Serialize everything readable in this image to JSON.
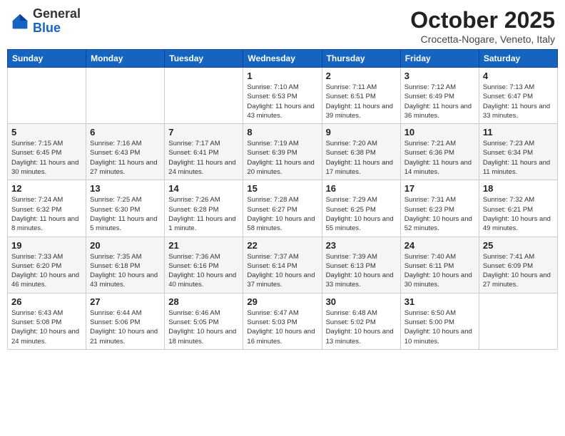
{
  "header": {
    "logo_general": "General",
    "logo_blue": "Blue",
    "month_title": "October 2025",
    "subtitle": "Crocetta-Nogare, Veneto, Italy"
  },
  "weekdays": [
    "Sunday",
    "Monday",
    "Tuesday",
    "Wednesday",
    "Thursday",
    "Friday",
    "Saturday"
  ],
  "weeks": [
    [
      {
        "day": "",
        "sunrise": "",
        "sunset": "",
        "daylight": ""
      },
      {
        "day": "",
        "sunrise": "",
        "sunset": "",
        "daylight": ""
      },
      {
        "day": "",
        "sunrise": "",
        "sunset": "",
        "daylight": ""
      },
      {
        "day": "1",
        "sunrise": "Sunrise: 7:10 AM",
        "sunset": "Sunset: 6:53 PM",
        "daylight": "Daylight: 11 hours and 43 minutes."
      },
      {
        "day": "2",
        "sunrise": "Sunrise: 7:11 AM",
        "sunset": "Sunset: 6:51 PM",
        "daylight": "Daylight: 11 hours and 39 minutes."
      },
      {
        "day": "3",
        "sunrise": "Sunrise: 7:12 AM",
        "sunset": "Sunset: 6:49 PM",
        "daylight": "Daylight: 11 hours and 36 minutes."
      },
      {
        "day": "4",
        "sunrise": "Sunrise: 7:13 AM",
        "sunset": "Sunset: 6:47 PM",
        "daylight": "Daylight: 11 hours and 33 minutes."
      }
    ],
    [
      {
        "day": "5",
        "sunrise": "Sunrise: 7:15 AM",
        "sunset": "Sunset: 6:45 PM",
        "daylight": "Daylight: 11 hours and 30 minutes."
      },
      {
        "day": "6",
        "sunrise": "Sunrise: 7:16 AM",
        "sunset": "Sunset: 6:43 PM",
        "daylight": "Daylight: 11 hours and 27 minutes."
      },
      {
        "day": "7",
        "sunrise": "Sunrise: 7:17 AM",
        "sunset": "Sunset: 6:41 PM",
        "daylight": "Daylight: 11 hours and 24 minutes."
      },
      {
        "day": "8",
        "sunrise": "Sunrise: 7:19 AM",
        "sunset": "Sunset: 6:39 PM",
        "daylight": "Daylight: 11 hours and 20 minutes."
      },
      {
        "day": "9",
        "sunrise": "Sunrise: 7:20 AM",
        "sunset": "Sunset: 6:38 PM",
        "daylight": "Daylight: 11 hours and 17 minutes."
      },
      {
        "day": "10",
        "sunrise": "Sunrise: 7:21 AM",
        "sunset": "Sunset: 6:36 PM",
        "daylight": "Daylight: 11 hours and 14 minutes."
      },
      {
        "day": "11",
        "sunrise": "Sunrise: 7:23 AM",
        "sunset": "Sunset: 6:34 PM",
        "daylight": "Daylight: 11 hours and 11 minutes."
      }
    ],
    [
      {
        "day": "12",
        "sunrise": "Sunrise: 7:24 AM",
        "sunset": "Sunset: 6:32 PM",
        "daylight": "Daylight: 11 hours and 8 minutes."
      },
      {
        "day": "13",
        "sunrise": "Sunrise: 7:25 AM",
        "sunset": "Sunset: 6:30 PM",
        "daylight": "Daylight: 11 hours and 5 minutes."
      },
      {
        "day": "14",
        "sunrise": "Sunrise: 7:26 AM",
        "sunset": "Sunset: 6:28 PM",
        "daylight": "Daylight: 11 hours and 1 minute."
      },
      {
        "day": "15",
        "sunrise": "Sunrise: 7:28 AM",
        "sunset": "Sunset: 6:27 PM",
        "daylight": "Daylight: 10 hours and 58 minutes."
      },
      {
        "day": "16",
        "sunrise": "Sunrise: 7:29 AM",
        "sunset": "Sunset: 6:25 PM",
        "daylight": "Daylight: 10 hours and 55 minutes."
      },
      {
        "day": "17",
        "sunrise": "Sunrise: 7:31 AM",
        "sunset": "Sunset: 6:23 PM",
        "daylight": "Daylight: 10 hours and 52 minutes."
      },
      {
        "day": "18",
        "sunrise": "Sunrise: 7:32 AM",
        "sunset": "Sunset: 6:21 PM",
        "daylight": "Daylight: 10 hours and 49 minutes."
      }
    ],
    [
      {
        "day": "19",
        "sunrise": "Sunrise: 7:33 AM",
        "sunset": "Sunset: 6:20 PM",
        "daylight": "Daylight: 10 hours and 46 minutes."
      },
      {
        "day": "20",
        "sunrise": "Sunrise: 7:35 AM",
        "sunset": "Sunset: 6:18 PM",
        "daylight": "Daylight: 10 hours and 43 minutes."
      },
      {
        "day": "21",
        "sunrise": "Sunrise: 7:36 AM",
        "sunset": "Sunset: 6:16 PM",
        "daylight": "Daylight: 10 hours and 40 minutes."
      },
      {
        "day": "22",
        "sunrise": "Sunrise: 7:37 AM",
        "sunset": "Sunset: 6:14 PM",
        "daylight": "Daylight: 10 hours and 37 minutes."
      },
      {
        "day": "23",
        "sunrise": "Sunrise: 7:39 AM",
        "sunset": "Sunset: 6:13 PM",
        "daylight": "Daylight: 10 hours and 33 minutes."
      },
      {
        "day": "24",
        "sunrise": "Sunrise: 7:40 AM",
        "sunset": "Sunset: 6:11 PM",
        "daylight": "Daylight: 10 hours and 30 minutes."
      },
      {
        "day": "25",
        "sunrise": "Sunrise: 7:41 AM",
        "sunset": "Sunset: 6:09 PM",
        "daylight": "Daylight: 10 hours and 27 minutes."
      }
    ],
    [
      {
        "day": "26",
        "sunrise": "Sunrise: 6:43 AM",
        "sunset": "Sunset: 5:08 PM",
        "daylight": "Daylight: 10 hours and 24 minutes."
      },
      {
        "day": "27",
        "sunrise": "Sunrise: 6:44 AM",
        "sunset": "Sunset: 5:06 PM",
        "daylight": "Daylight: 10 hours and 21 minutes."
      },
      {
        "day": "28",
        "sunrise": "Sunrise: 6:46 AM",
        "sunset": "Sunset: 5:05 PM",
        "daylight": "Daylight: 10 hours and 18 minutes."
      },
      {
        "day": "29",
        "sunrise": "Sunrise: 6:47 AM",
        "sunset": "Sunset: 5:03 PM",
        "daylight": "Daylight: 10 hours and 16 minutes."
      },
      {
        "day": "30",
        "sunrise": "Sunrise: 6:48 AM",
        "sunset": "Sunset: 5:02 PM",
        "daylight": "Daylight: 10 hours and 13 minutes."
      },
      {
        "day": "31",
        "sunrise": "Sunrise: 6:50 AM",
        "sunset": "Sunset: 5:00 PM",
        "daylight": "Daylight: 10 hours and 10 minutes."
      },
      {
        "day": "",
        "sunrise": "",
        "sunset": "",
        "daylight": ""
      }
    ]
  ]
}
